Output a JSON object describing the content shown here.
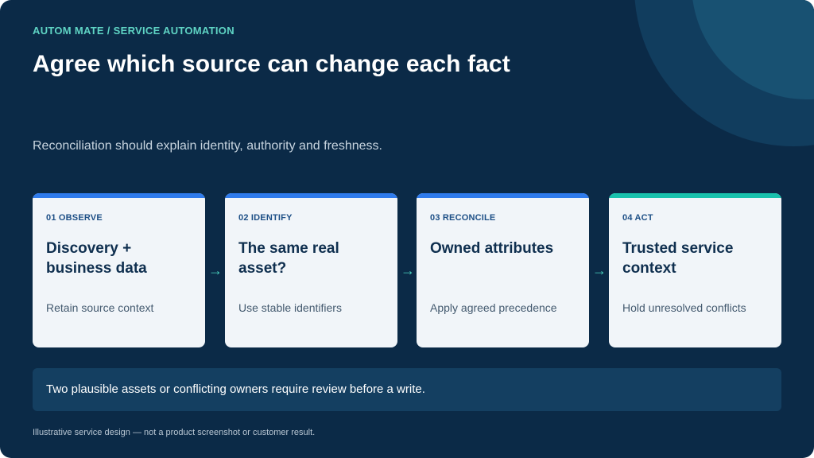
{
  "header": {
    "eyebrow": "AUTOM MATE / SERVICE AUTOMATION",
    "title": "Agree which source can change each fact",
    "subtitle": "Reconciliation should explain identity, authority and freshness."
  },
  "colors": {
    "background": "#0b2a47",
    "accent_blue": "#2f7bec",
    "accent_teal": "#19c2ad",
    "card_background": "#f1f5f9"
  },
  "steps": [
    {
      "step": "01 OBSERVE",
      "title": "Discovery + business data",
      "description": "Retain source context",
      "bar_color": "#2f7bec"
    },
    {
      "step": "02 IDENTIFY",
      "title": "The same real asset?",
      "description": "Use stable identifiers",
      "bar_color": "#2f7bec"
    },
    {
      "step": "03 RECONCILE",
      "title": "Owned attributes",
      "description": "Apply agreed precedence",
      "bar_color": "#2f7bec"
    },
    {
      "step": "04 ACT",
      "title": "Trusted service context",
      "description": "Hold unresolved conflicts",
      "bar_color": "#19c2ad"
    }
  ],
  "arrows": {
    "glyph": "→",
    "icon": "arrow-right-icon"
  },
  "callout": {
    "text": "Two plausible assets or conflicting owners require review before a write."
  },
  "footnote": {
    "text": "Illustrative service design — not a product screenshot or customer result."
  }
}
